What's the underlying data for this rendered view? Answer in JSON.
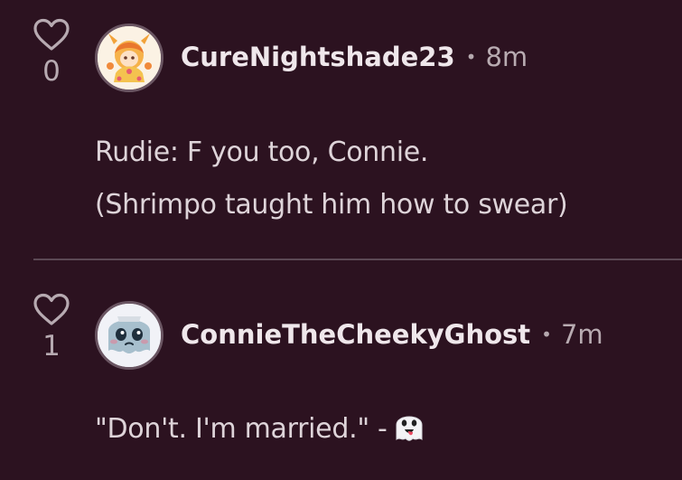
{
  "colors": {
    "background": "#2c1220",
    "text": "#ece4e8",
    "muted": "#b7aab1",
    "divider": "#5b4854"
  },
  "comments": [
    {
      "likes": "0",
      "avatar_icon": "anime-character-avatar",
      "username": "CureNightshade23",
      "separator": "•",
      "time": "8m",
      "lines": [
        "Rudie: F you too, Connie.",
        "(Shrimpo taught him how to swear)"
      ]
    },
    {
      "likes": "1",
      "avatar_icon": "ghost-character-avatar",
      "username": "ConnieTheCheekyGhost",
      "separator": "•",
      "time": "7m",
      "lines": [
        "\"Don't. I'm married.\" -"
      ],
      "trailing_emoji": "ghost-emoji-icon"
    }
  ]
}
